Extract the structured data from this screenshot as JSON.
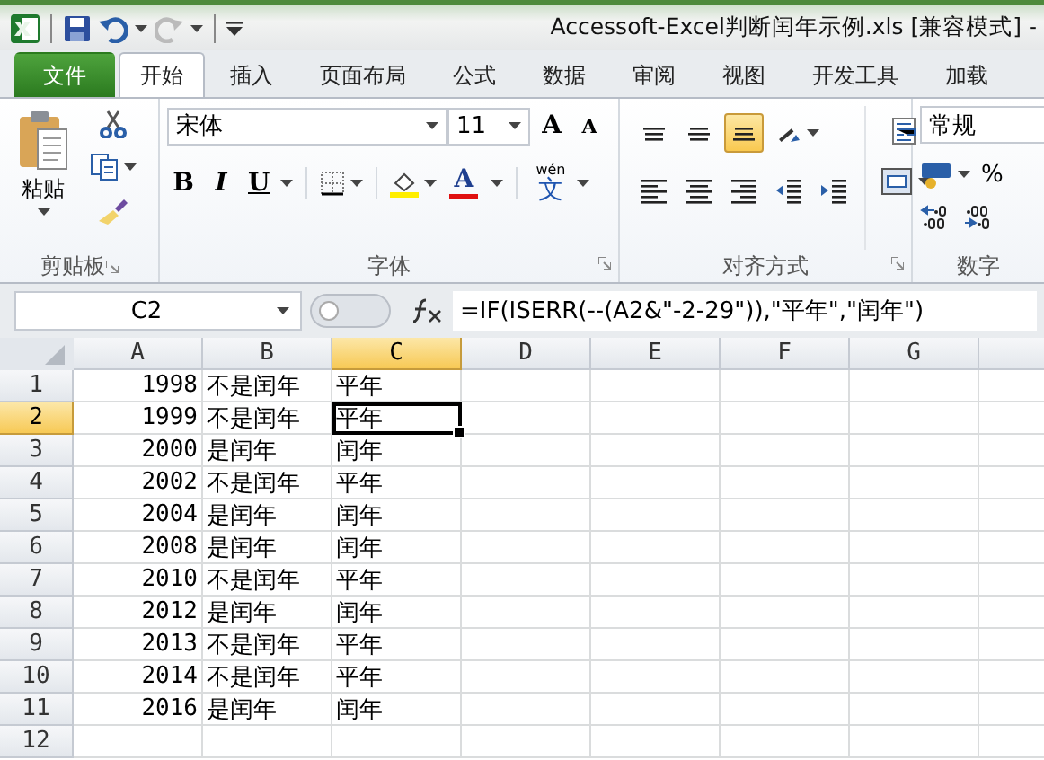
{
  "title_bar": {
    "title": "Accessoft-Excel判断闰年示例.xls  [兼容模式] -"
  },
  "tabs": [
    {
      "label": "文件",
      "kind": "file",
      "selected": false
    },
    {
      "label": "开始",
      "kind": "tab",
      "selected": true
    },
    {
      "label": "插入",
      "kind": "tab",
      "selected": false
    },
    {
      "label": "页面布局",
      "kind": "tab",
      "selected": false
    },
    {
      "label": "公式",
      "kind": "tab",
      "selected": false
    },
    {
      "label": "数据",
      "kind": "tab",
      "selected": false
    },
    {
      "label": "审阅",
      "kind": "tab",
      "selected": false
    },
    {
      "label": "视图",
      "kind": "tab",
      "selected": false
    },
    {
      "label": "开发工具",
      "kind": "tab",
      "selected": false
    },
    {
      "label": "加载",
      "kind": "tab",
      "selected": false
    }
  ],
  "ribbon": {
    "clipboard": {
      "paste_label": "粘贴",
      "group_label": "剪贴板"
    },
    "font": {
      "font_name": "宋体",
      "font_size": "11",
      "grow": "A",
      "shrink": "A",
      "bold": "B",
      "italic": "I",
      "underline": "U",
      "font_color": "A",
      "phonetic_top": "wén",
      "phonetic_bottom": "文",
      "group_label": "字体"
    },
    "alignment": {
      "buttons": [
        {
          "kind": "top",
          "selected": false
        },
        {
          "kind": "middle",
          "selected": false
        },
        {
          "kind": "bottom",
          "selected": true
        },
        {
          "kind": "orientation",
          "selected": false
        },
        {
          "kind": "left",
          "selected": false
        },
        {
          "kind": "center",
          "selected": false
        },
        {
          "kind": "right",
          "selected": false
        },
        {
          "kind": "outdent",
          "selected": false
        },
        {
          "kind": "indent",
          "selected": false
        }
      ],
      "group_label": "对齐方式"
    },
    "number": {
      "format": "常规",
      "percent": "%",
      "group_label": "数字"
    }
  },
  "formula_bar": {
    "name_box": "C2",
    "formula": "=IF(ISERR(--(A2&\"-2-29\")),\"平年\",\"闰年\")"
  },
  "sheet": {
    "columns": [
      {
        "label": "A",
        "selected": false
      },
      {
        "label": "B",
        "selected": false
      },
      {
        "label": "C",
        "selected": true
      },
      {
        "label": "D",
        "selected": false
      },
      {
        "label": "E",
        "selected": false
      },
      {
        "label": "F",
        "selected": false
      },
      {
        "label": "G",
        "selected": false
      }
    ],
    "rows": [
      {
        "label": "1",
        "selected": false,
        "cells": [
          "1998",
          "不是闰年",
          "平年"
        ]
      },
      {
        "label": "2",
        "selected": true,
        "cells": [
          "1999",
          "不是闰年",
          "平年"
        ]
      },
      {
        "label": "3",
        "selected": false,
        "cells": [
          "2000",
          "是闰年",
          "闰年"
        ]
      },
      {
        "label": "4",
        "selected": false,
        "cells": [
          "2002",
          "不是闰年",
          "平年"
        ]
      },
      {
        "label": "5",
        "selected": false,
        "cells": [
          "2004",
          "是闰年",
          "闰年"
        ]
      },
      {
        "label": "6",
        "selected": false,
        "cells": [
          "2008",
          "是闰年",
          "闰年"
        ]
      },
      {
        "label": "7",
        "selected": false,
        "cells": [
          "2010",
          "不是闰年",
          "平年"
        ]
      },
      {
        "label": "8",
        "selected": false,
        "cells": [
          "2012",
          "是闰年",
          "闰年"
        ]
      },
      {
        "label": "9",
        "selected": false,
        "cells": [
          "2013",
          "不是闰年",
          "平年"
        ]
      },
      {
        "label": "10",
        "selected": false,
        "cells": [
          "2014",
          "不是闰年",
          "平年"
        ]
      },
      {
        "label": "11",
        "selected": false,
        "cells": [
          "2016",
          "是闰年",
          "闰年"
        ]
      },
      {
        "label": "12",
        "selected": false,
        "cells": []
      }
    ]
  }
}
